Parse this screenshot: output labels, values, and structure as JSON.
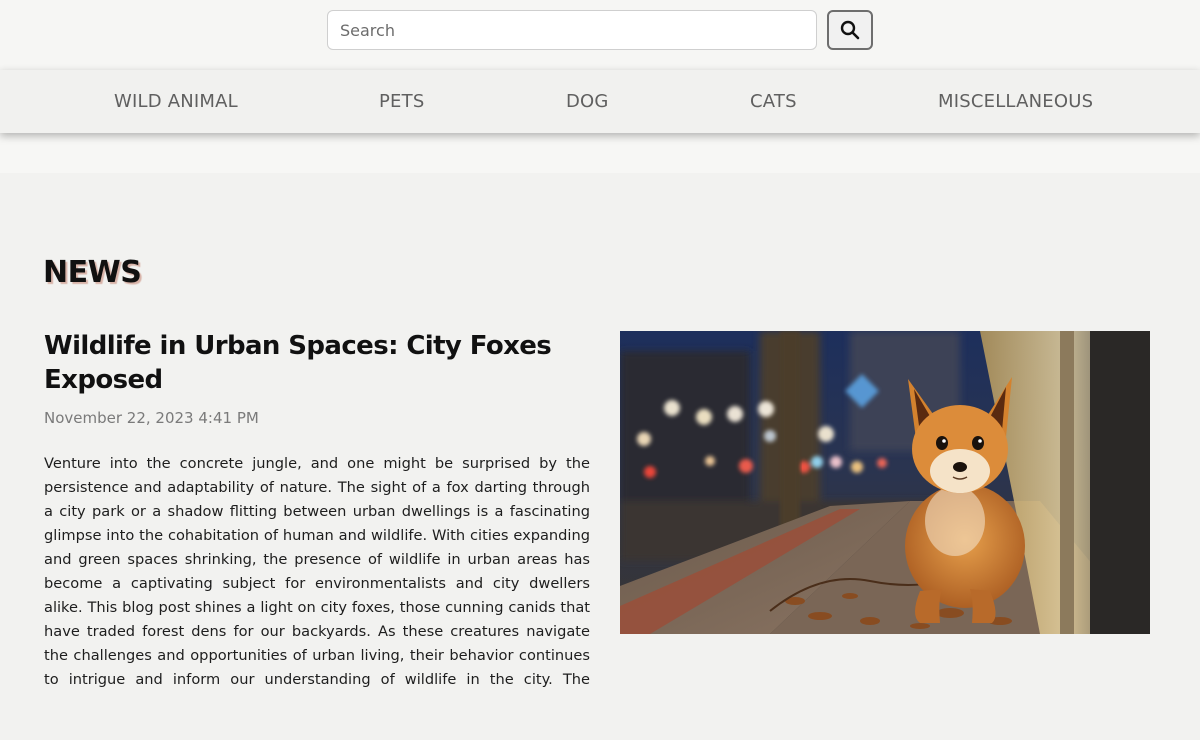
{
  "search": {
    "placeholder": "Search"
  },
  "nav": {
    "items": [
      {
        "label": "WILD ANIMAL"
      },
      {
        "label": "PETS"
      },
      {
        "label": "DOG"
      },
      {
        "label": "CATS"
      },
      {
        "label": "MISCELLANEOUS"
      }
    ]
  },
  "section": {
    "title": "NEWS"
  },
  "post": {
    "title": "Wildlife in Urban Spaces: City Foxes Exposed",
    "date": "November 22, 2023 4:41 PM",
    "excerpt": "Venture into the concrete jungle, and one might be surprised by the persistence and adaptability of nature. The sight of a fox darting through a city park or a shadow flitting between urban dwellings is a fascinating glimpse into the cohabitation of human and wildlife. With cities expanding and green spaces shrinking, the presence of wildlife in urban areas has become a captivating subject for environmentalists and city dwellers alike. This blog post shines a light on city foxes, those cunning canids that have traded forest dens for our backyards. As these creatures navigate the challenges and opportunities of urban living, their behavior continues to intrigue and inform our understanding of wildlife in the city. The explorati..."
  }
}
